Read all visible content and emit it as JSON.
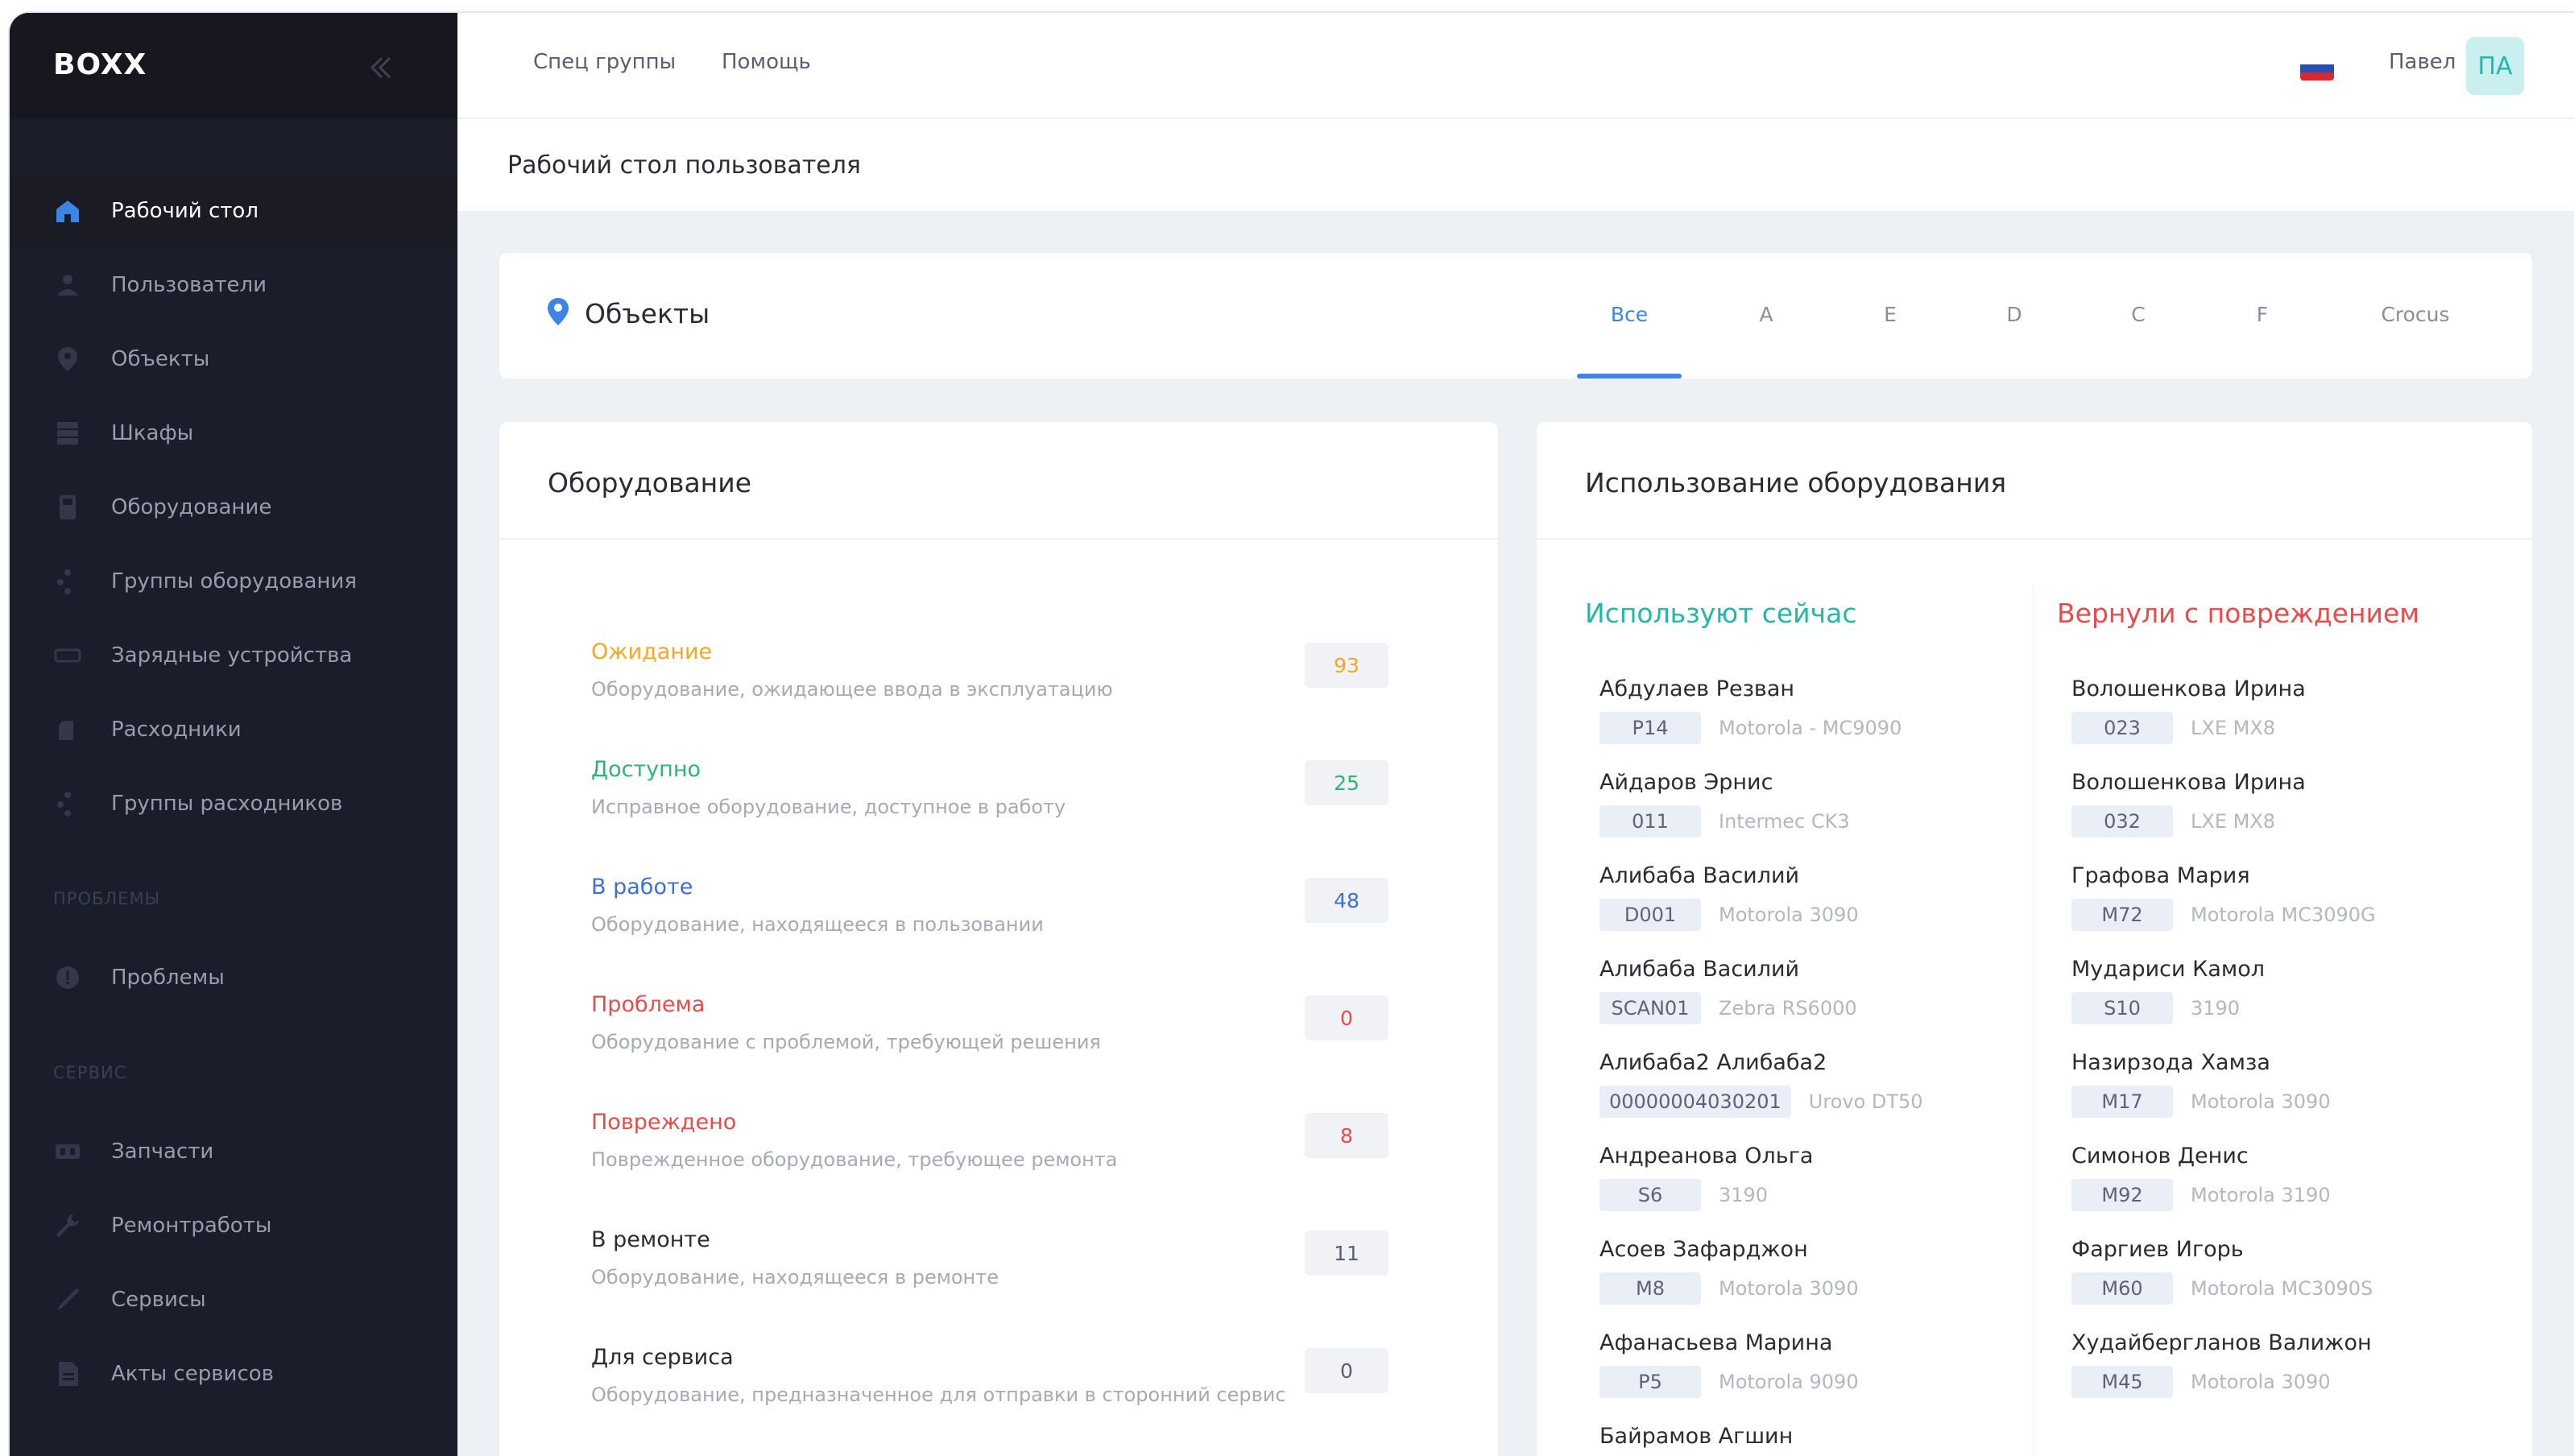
{
  "app": {
    "logo": "BOXX"
  },
  "sidebar": {
    "items": [
      {
        "label": "Рабочий стол",
        "icon": "home-icon",
        "active": true
      },
      {
        "label": "Пользователи",
        "icon": "user-icon"
      },
      {
        "label": "Объекты",
        "icon": "location-pin-icon"
      },
      {
        "label": "Шкафы",
        "icon": "cabinet-icon"
      },
      {
        "label": "Оборудование",
        "icon": "device-icon"
      },
      {
        "label": "Группы оборудования",
        "icon": "group-icon"
      },
      {
        "label": "Зарядные устройства",
        "icon": "charger-icon"
      },
      {
        "label": "Расходники",
        "icon": "consumables-icon"
      },
      {
        "label": "Группы расходников",
        "icon": "group-icon"
      }
    ],
    "section_problems": "ПРОБЛЕМЫ",
    "problems_items": [
      {
        "label": "Проблемы",
        "icon": "alert-icon"
      }
    ],
    "section_service": "СЕРВИС",
    "service_items": [
      {
        "label": "Запчасти",
        "icon": "parts-icon"
      },
      {
        "label": "Ремонтработы",
        "icon": "wrench-icon"
      },
      {
        "label": "Сервисы",
        "icon": "tool-icon"
      },
      {
        "label": "Акты сервисов",
        "icon": "document-icon"
      }
    ]
  },
  "topbar": {
    "links": [
      "Спец группы",
      "Помощь"
    ],
    "user_name": "Павел",
    "avatar_initials": "ПА",
    "flag": "russia-flag-icon"
  },
  "page": {
    "title": "Рабочий стол пользователя"
  },
  "objects": {
    "title": "Объекты",
    "tabs": [
      "Все",
      "A",
      "E",
      "D",
      "C",
      "F",
      "Crocus"
    ],
    "active_tab": "Все"
  },
  "equipment": {
    "title": "Оборудование",
    "statuses": [
      {
        "name": "Ожидание",
        "desc": "Оборудование, ожидающее ввода в эксплуатацию",
        "count": "93",
        "color": "#f5a623"
      },
      {
        "name": "Доступно",
        "desc": "Исправное оборудование, доступное в работу",
        "count": "25",
        "color": "#2bb673"
      },
      {
        "name": "В работе",
        "desc": "Оборудование, находящееся в пользовании",
        "count": "48",
        "color": "#3d6fd6"
      },
      {
        "name": "Проблема",
        "desc": "Оборудование с проблемой, требующей решения",
        "count": "0",
        "color": "#e94b4b"
      },
      {
        "name": "Повреждено",
        "desc": "Поврежденное оборудование, требующее ремонта",
        "count": "8",
        "color": "#e94b4b"
      },
      {
        "name": "В ремонте",
        "desc": "Оборудование, находящееся в ремонте",
        "count": "11",
        "color": "#2b2b33"
      },
      {
        "name": "Для сервиса",
        "desc": "Оборудование, предназначенное для отправки в сторонний сервис",
        "count": "0",
        "color": "#2b2b33"
      }
    ]
  },
  "usage": {
    "title": "Использование оборудования",
    "in_use": {
      "title": "Используют сейчас",
      "color": "#23b7a8",
      "people": [
        {
          "name": "Абдулаев Резван",
          "code": "P14",
          "device": "Motorola - MC9090"
        },
        {
          "name": "Айдаров Эрнис",
          "code": "011",
          "device": "Intermec CK3"
        },
        {
          "name": "Алибаба Василий",
          "code": "D001",
          "device": "Motorola 3090"
        },
        {
          "name": "Алибаба Василий",
          "code": "SCAN01",
          "device": "Zebra RS6000"
        },
        {
          "name": "Алибаба2 Алибаба2",
          "code": "00000004030201",
          "device": "Urovo DT50"
        },
        {
          "name": "Андреанова Ольга",
          "code": "S6",
          "device": "3190"
        },
        {
          "name": "Асоев Зафарджон",
          "code": "M8",
          "device": "Motorola 3090"
        },
        {
          "name": "Афанасьева Марина",
          "code": "P5",
          "device": "Motorola 9090"
        },
        {
          "name": "Байрамов Агшин",
          "code": "",
          "device": ""
        }
      ]
    },
    "damaged": {
      "title": "Вернули с повреждением",
      "color": "#e94b4b",
      "people": [
        {
          "name": "Волошенкова Ирина",
          "code": "023",
          "device": "LXE MX8"
        },
        {
          "name": "Волошенкова Ирина",
          "code": "032",
          "device": "LXE MX8"
        },
        {
          "name": "Графова Мария",
          "code": "M72",
          "device": "Motorola MC3090G"
        },
        {
          "name": "Мудариси Камол",
          "code": "S10",
          "device": "3190"
        },
        {
          "name": "Назирзода Хамза",
          "code": "M17",
          "device": "Motorola 3090"
        },
        {
          "name": "Симонов Денис",
          "code": "M92",
          "device": "Motorola 3190"
        },
        {
          "name": "Фаргиев Игорь",
          "code": "M60",
          "device": "Motorola MC3090S"
        },
        {
          "name": "Худайбергланов Валижон",
          "code": "M45",
          "device": "Motorola 3090"
        }
      ]
    }
  }
}
